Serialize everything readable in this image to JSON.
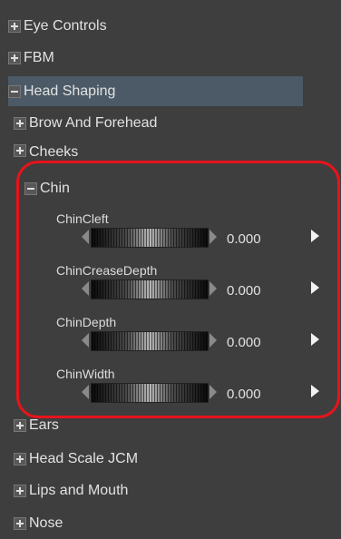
{
  "tree": {
    "top_items": [
      {
        "label": "Eye Controls",
        "expanded": false
      },
      {
        "label": "FBM",
        "expanded": false
      },
      {
        "label": "Head Shaping",
        "expanded": true
      }
    ],
    "head_shaping_children": [
      {
        "label": "Brow And Forehead",
        "expanded": false
      },
      {
        "label": "Cheeks",
        "expanded": false
      },
      {
        "label": "Chin",
        "expanded": true
      }
    ],
    "chin_properties": [
      {
        "name": "ChinCleft",
        "value": "0.000"
      },
      {
        "name": "ChinCreaseDepth",
        "value": "0.000"
      },
      {
        "name": "ChinDepth",
        "value": "0.000"
      },
      {
        "name": "ChinWidth",
        "value": "0.000"
      }
    ],
    "after_items": [
      {
        "label": "Ears",
        "expanded": false
      },
      {
        "label": "Head Scale JCM",
        "expanded": false
      },
      {
        "label": "Lips and Mouth",
        "expanded": false
      },
      {
        "label": "Nose",
        "expanded": false
      }
    ]
  },
  "annotation": {
    "color": "#e8131b"
  },
  "colors": {
    "background": "#3e3e3e",
    "selected_row": "#4b5a66"
  }
}
